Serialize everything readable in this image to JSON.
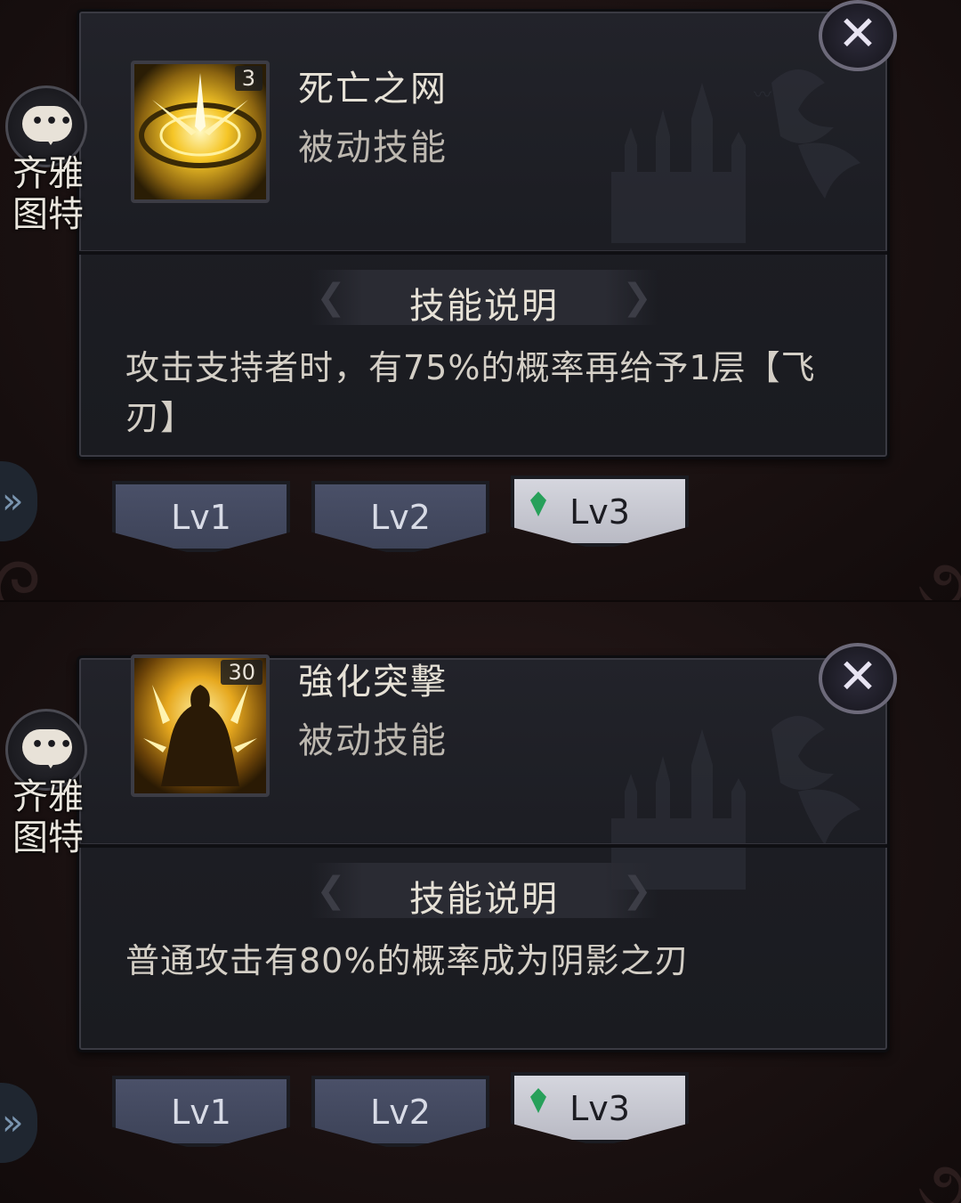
{
  "panels": [
    {
      "character_name": "齐雅\n图特",
      "skill_name": "死亡之网",
      "skill_type": "被动技能",
      "icon_level": "3",
      "section_title": "技能说明",
      "description": "攻击支持者时，有75%的概率再给予1层【飞刃】",
      "levels": [
        "Lv1",
        "Lv2",
        "Lv3"
      ],
      "selected_level": "Lv3",
      "close_label": "✕",
      "side_arrow": "»"
    },
    {
      "character_name": "齐雅\n图特",
      "skill_name": "強化突擊",
      "skill_type": "被动技能",
      "icon_level": "30",
      "section_title": "技能说明",
      "description": "普通攻击有80%的概率成为阴影之刃",
      "levels": [
        "Lv1",
        "Lv2",
        "Lv3"
      ],
      "selected_level": "Lv3",
      "close_label": "✕",
      "side_arrow": "»"
    }
  ],
  "colors": {
    "accent_gold": "#f5c526",
    "tab_inactive": "#4a5068",
    "tab_active": "#d5d6de",
    "gem_green": "#27a05a"
  },
  "icons": {
    "chat": "chat-bubble-icon",
    "close": "close-icon",
    "gem": "gem-icon",
    "arrow": "double-chevron-right-icon"
  }
}
